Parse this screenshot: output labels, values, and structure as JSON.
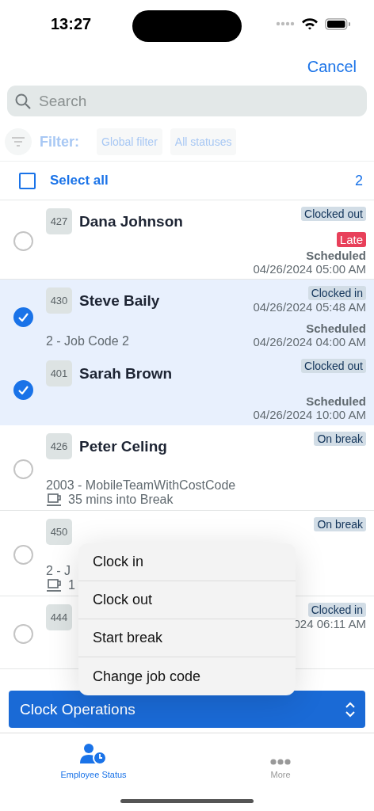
{
  "status_bar": {
    "time": "13:27"
  },
  "header": {
    "cancel": "Cancel"
  },
  "search": {
    "placeholder": "Search"
  },
  "filter": {
    "label": "Filter:",
    "chips": [
      "Global filter",
      "All statuses"
    ]
  },
  "select_all": {
    "label": "Select all",
    "checked": false,
    "count": "2"
  },
  "rows": [
    {
      "id": "427",
      "name": "Dana Johnson",
      "status": "Clocked out",
      "late": "Late",
      "scheduled_label": "Scheduled",
      "scheduled": "04/26/2024 05:00 AM",
      "selected": false
    },
    {
      "id": "430",
      "name": "Steve Baily",
      "status": "Clocked in",
      "status_time": "04/26/2024 05:48 AM",
      "job": "2 - Job Code 2",
      "scheduled_label": "Scheduled",
      "scheduled": "04/26/2024 04:00 AM",
      "selected": true
    },
    {
      "id": "401",
      "name": "Sarah Brown",
      "status": "Clocked out",
      "scheduled_label": "Scheduled",
      "scheduled": "04/26/2024 10:00 AM",
      "selected": true
    },
    {
      "id": "426",
      "name": "Peter Celing",
      "status": "On break",
      "job": "2003 - MobileTeamWithCostCode",
      "break": "35 mins into Break",
      "selected": false
    },
    {
      "id": "450",
      "status": "On break",
      "job": "2 - J",
      "break": "1",
      "selected": false
    },
    {
      "id": "444",
      "status": "Clocked in",
      "status_time": "024 06:11 AM",
      "selected": false
    }
  ],
  "menu": {
    "items": [
      "Clock in",
      "Clock out",
      "Start break",
      "Change job code"
    ]
  },
  "action": {
    "label": "Clock Operations"
  },
  "tabs": [
    {
      "label": "Employee Status",
      "kind": "employee",
      "selected": true
    },
    {
      "label": "More",
      "kind": "more",
      "selected": false
    }
  ]
}
